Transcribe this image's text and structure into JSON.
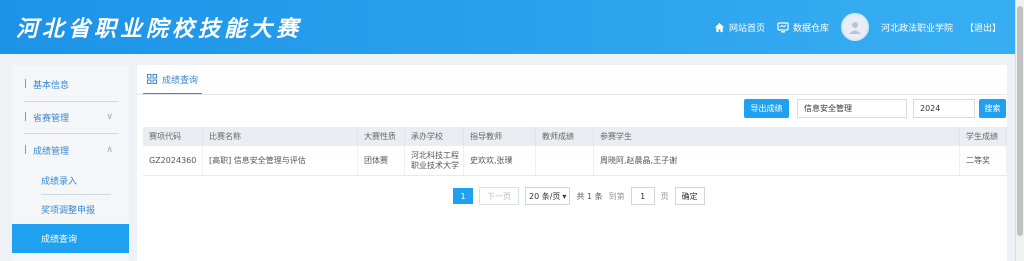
{
  "header": {
    "title": "河北省职业院校技能大赛",
    "nav": [
      {
        "icon": "home-icon",
        "label": "网站首页"
      },
      {
        "icon": "database-icon",
        "label": "数据仓库"
      }
    ],
    "user": "河北政法职业学院",
    "logout": "【退出】"
  },
  "sidebar": {
    "basic_info": "基本信息",
    "province_manage": "省赛管理",
    "score_manage": "成绩管理",
    "subitems": [
      "成绩录入",
      "奖项调整申报",
      "成绩查询"
    ]
  },
  "main": {
    "tab": "成绩查询",
    "export_btn": "导出成绩",
    "search_value": "信息安全管理",
    "year_value": "2024",
    "search_btn": "搜索",
    "columns": [
      "赛项代码",
      "比赛名称",
      "大赛性质",
      "承办学校",
      "指导教师",
      "教师成绩",
      "参赛学生",
      "学生成绩"
    ],
    "rows": [
      {
        "code": "GZ2024360",
        "name": "[高职] 信息安全管理与评估",
        "nature": "团体赛",
        "school_line1": "河北科技工程",
        "school_line2": "职业技术大学",
        "teachers": "史欢欢,张璞",
        "teacher_score": "",
        "students": "周晓阿,赵晨晶,王子谢",
        "student_score": "二等奖"
      }
    ],
    "pager": {
      "current": "1",
      "next": "下一页",
      "page_size": "20 条/页",
      "total": "共 1 条",
      "goto_label": "到第",
      "goto_value": "1",
      "page_unit": "页",
      "confirm": "确定"
    }
  }
}
